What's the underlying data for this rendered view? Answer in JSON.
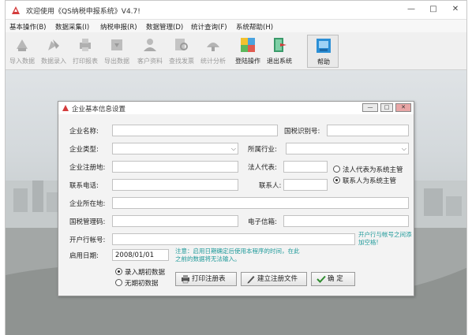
{
  "window": {
    "title": "欢迎使用《QS纳税申报系统》V4.7!"
  },
  "window_controls": {
    "minimize": "—",
    "maximize": "□",
    "close": "✕"
  },
  "menu": [
    "基本操作(B)",
    "数据采集(I)",
    "纳税申报(R)",
    "数据管理(D)",
    "统计查询(F)",
    "系统帮助(H)"
  ],
  "toolbar": [
    {
      "label": "导入数据",
      "icon": "import-icon",
      "enabled": false
    },
    {
      "label": "数据录入",
      "icon": "data-entry-icon",
      "enabled": false
    },
    {
      "label": "打印报表",
      "icon": "print-report-icon",
      "enabled": false
    },
    {
      "label": "导出数据",
      "icon": "export-icon",
      "enabled": false
    },
    {
      "label": "客户资料",
      "icon": "customer-icon",
      "enabled": false
    },
    {
      "label": "查找发票",
      "icon": "invoice-search-icon",
      "enabled": false
    },
    {
      "label": "统计分析",
      "icon": "statistics-icon",
      "enabled": false
    },
    {
      "label": "登陆操作",
      "icon": "login-icon",
      "enabled": true
    },
    {
      "label": "退出系统",
      "icon": "exit-icon",
      "enabled": true
    },
    {
      "label": "帮助",
      "icon": "help-icon",
      "enabled": true
    }
  ],
  "dialog": {
    "title": "企业基本信息设置",
    "fields": {
      "company_name": {
        "label": "企业名称:",
        "value": ""
      },
      "tax_id": {
        "label": "国税识别号:",
        "value": ""
      },
      "company_type": {
        "label": "企业类型:",
        "value": ""
      },
      "industry": {
        "label": "所属行业:",
        "value": ""
      },
      "registered_address": {
        "label": "企业注册地:",
        "value": ""
      },
      "legal_rep": {
        "label": "法人代表:",
        "value": ""
      },
      "phone": {
        "label": "联系电话:",
        "value": ""
      },
      "contact": {
        "label": "联系人:",
        "value": ""
      },
      "location": {
        "label": "企业所在地:",
        "value": ""
      },
      "tax_authority_code": {
        "label": "国税管理码:",
        "value": ""
      },
      "email": {
        "label": "电子信箱:",
        "value": ""
      },
      "bank_account": {
        "label": "开户行帐号:",
        "value": ""
      },
      "start_date": {
        "label": "启用日期:",
        "value": "2008/01/01"
      }
    },
    "bank_note": "开户行与帐号之间添加空格!",
    "date_note": "注意：启用日期确定后使用本程序的时间，在此之前的数据将无法输入。",
    "main_supervisor": {
      "options": [
        "法人代表为系统主管",
        "联系人为系统主管"
      ],
      "selected": 1
    },
    "initial_data": {
      "options": [
        "录入期初数据",
        "无期初数据"
      ],
      "selected": 0
    },
    "buttons": {
      "print": "打印注册表",
      "register": "建立注册文件",
      "ok": "确  定"
    }
  },
  "colors": {
    "note": "#1f9a9a",
    "window_bg": "#f0f0f0",
    "dialog_bg": "#f3f3f3"
  }
}
